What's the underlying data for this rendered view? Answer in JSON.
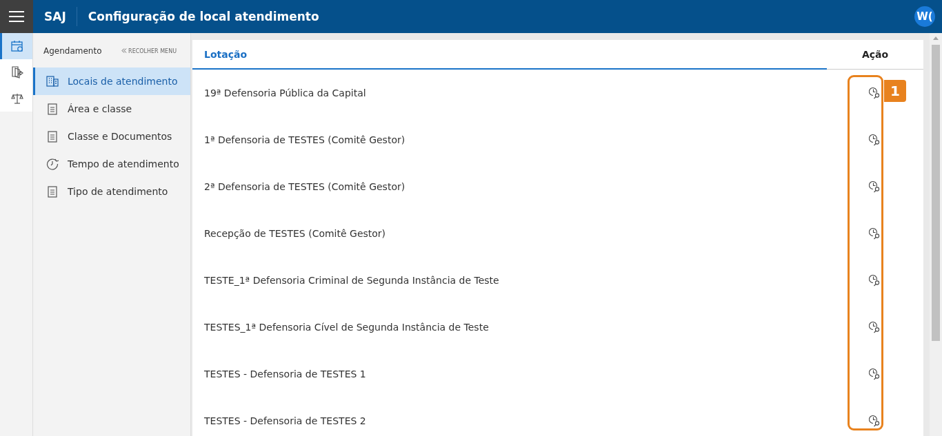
{
  "header": {
    "brand": "SAJ",
    "title": "Configuração de local atendimento",
    "avatar": "W("
  },
  "rail": [
    {
      "kind": "calendar",
      "selected": true
    },
    {
      "kind": "export",
      "selected": false
    },
    {
      "kind": "scales",
      "selected": false
    }
  ],
  "sidebar": {
    "title": "Agendamento",
    "collapse": "RECOLHER MENU",
    "items": [
      {
        "label": "Locais de atendimento",
        "kind": "building",
        "selected": true
      },
      {
        "label": "Área e classe",
        "kind": "document",
        "selected": false
      },
      {
        "label": "Classe e Documentos",
        "kind": "document",
        "selected": false
      },
      {
        "label": "Tempo de atendimento",
        "kind": "clock",
        "selected": false
      },
      {
        "label": "Tipo de atendimento",
        "kind": "document",
        "selected": false
      }
    ]
  },
  "table": {
    "columns": [
      "Lotação",
      "Ação"
    ],
    "rows": [
      "19ª Defensoria Pública da Capital",
      "1ª Defensoria de TESTES (Comitê Gestor)",
      "2ª Defensoria de TESTES (Comitê Gestor)",
      "Recepção de TESTES (Comitê Gestor)",
      "TESTE_1ª Defensoria Criminal de Segunda Instância de Teste",
      "TESTES_1ª Defensoria Cível de Segunda Instância de Teste",
      "TESTES - Defensoria de TESTES 1",
      "TESTES - Defensoria de TESTES 2"
    ]
  },
  "annotation": {
    "badge": "1"
  }
}
